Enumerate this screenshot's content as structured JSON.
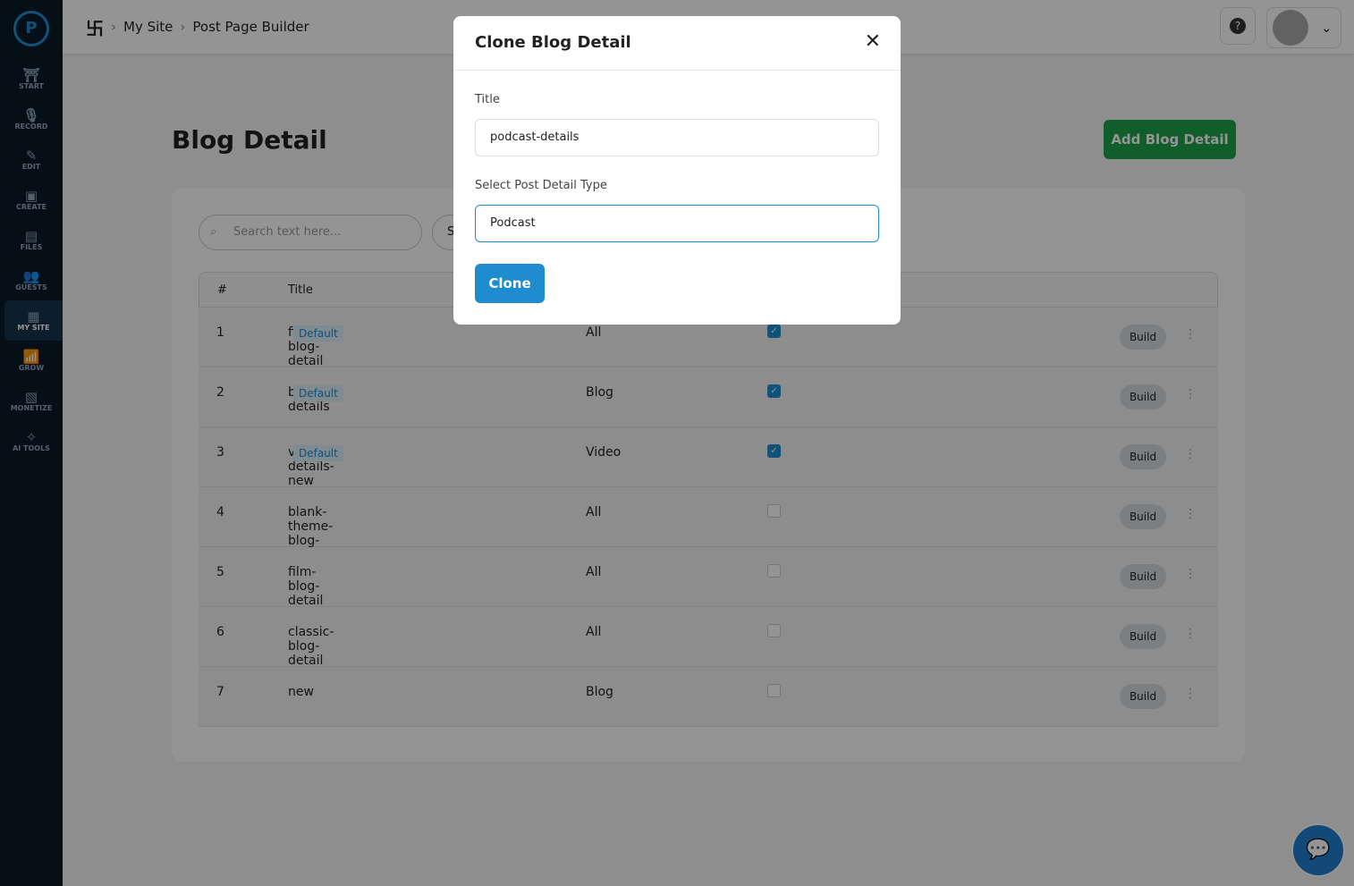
{
  "sidebar": {
    "items": [
      {
        "label": "START",
        "icon": "start-icon"
      },
      {
        "label": "RECORD",
        "icon": "mic-icon"
      },
      {
        "label": "EDIT",
        "icon": "edit-icon"
      },
      {
        "label": "CREATE",
        "icon": "create-icon"
      },
      {
        "label": "FILES",
        "icon": "files-icon"
      },
      {
        "label": "GUESTS",
        "icon": "guests-icon"
      },
      {
        "label": "MY SITE",
        "icon": "site-icon",
        "active": true
      },
      {
        "label": "GROW",
        "icon": "grow-icon"
      },
      {
        "label": "MONETIZE",
        "icon": "monetize-icon"
      },
      {
        "label": "AI TOOLS",
        "icon": "ai-icon"
      }
    ]
  },
  "breadcrumb": {
    "site": "My Site",
    "page": "Post Page Builder"
  },
  "header": {
    "help": "?"
  },
  "page": {
    "title": "Blog Detail",
    "add_button": "Add Blog Detail",
    "search_placeholder": "Search text here...",
    "filter_button": "S"
  },
  "table": {
    "headers": [
      "#",
      "Title"
    ],
    "badge": "Default",
    "build": "Build",
    "rows": [
      {
        "n": "1",
        "title": "fitness-blog-detail",
        "default": true,
        "type": "All",
        "checked": true
      },
      {
        "n": "2",
        "title": "blog-details",
        "default": true,
        "type": "Blog",
        "checked": true
      },
      {
        "n": "3",
        "title": "video-details-new",
        "default": true,
        "type": "Video",
        "checked": true
      },
      {
        "n": "4",
        "title": "blank-theme-blog-detail",
        "default": false,
        "type": "All",
        "checked": false
      },
      {
        "n": "5",
        "title": "film-blog-detail",
        "default": false,
        "type": "All",
        "checked": false
      },
      {
        "n": "6",
        "title": "classic-blog-detail",
        "default": false,
        "type": "All",
        "checked": false
      },
      {
        "n": "7",
        "title": "new",
        "default": false,
        "type": "Blog",
        "checked": false
      }
    ]
  },
  "modal": {
    "title": "Clone Blog Detail",
    "title_label": "Title",
    "title_value": "podcast-details",
    "type_label": "Select Post Detail Type",
    "type_value": "Podcast",
    "clone_button": "Clone"
  },
  "colors": {
    "accent": "#1f8ccf",
    "add": "#1ea34a",
    "sidebar": "#0a1a2a"
  }
}
